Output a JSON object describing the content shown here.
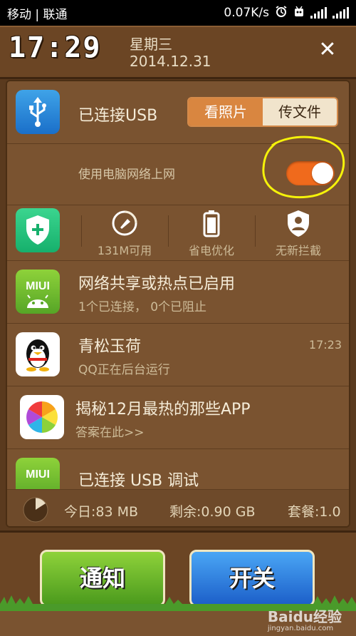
{
  "status_bar": {
    "carrier": "移动 | 联通",
    "speed": "0.07K/s"
  },
  "header": {
    "time": "17:29",
    "weekday": "星期三",
    "date": "2014.12.31",
    "close_glyph": "✕"
  },
  "usb": {
    "title": "已连接USB",
    "segment_left": "看照片",
    "segment_right": "传文件",
    "selected": "看照片"
  },
  "network": {
    "label": "使用电脑网络上网",
    "toggle_on": true
  },
  "tools": [
    {
      "label": "131M可用",
      "icon": "broom-icon"
    },
    {
      "label": "省电优化",
      "icon": "battery-icon"
    },
    {
      "label": "无新拦截",
      "icon": "shield-person-icon"
    }
  ],
  "notifications": [
    {
      "title": "网络共享或热点已启用",
      "subtitle": "1个已连接， 0个已阻止",
      "time": "",
      "icon": "miui-android-icon",
      "badge": "MIUI"
    },
    {
      "title": "青松玉荷",
      "subtitle": "QQ正在后台运行",
      "time": "17:23",
      "icon": "qq-penguin-icon"
    },
    {
      "title": "揭秘12月最热的那些APP",
      "subtitle": "答案在此>>",
      "time": "",
      "icon": "app-store-icon"
    },
    {
      "title": "已连接 USB 调试",
      "subtitle": "",
      "time": "",
      "icon": "miui-android-icon",
      "badge": "MIUI"
    }
  ],
  "data_usage": {
    "today": "今日:83 MB",
    "remaining": "剩余:0.90 GB",
    "plan": "套餐:1.0"
  },
  "bottom": {
    "notify_label": "通知",
    "switch_label": "开关"
  },
  "watermark": {
    "title": "Baidu经验",
    "url": "jingyan.baidu.com"
  },
  "colors": {
    "toggle": "#f06a1c",
    "segment_active": "#d98640",
    "notify_button": "#5fae24",
    "switch_button": "#2a78e0",
    "annotation_circle": "#f5f20a"
  }
}
